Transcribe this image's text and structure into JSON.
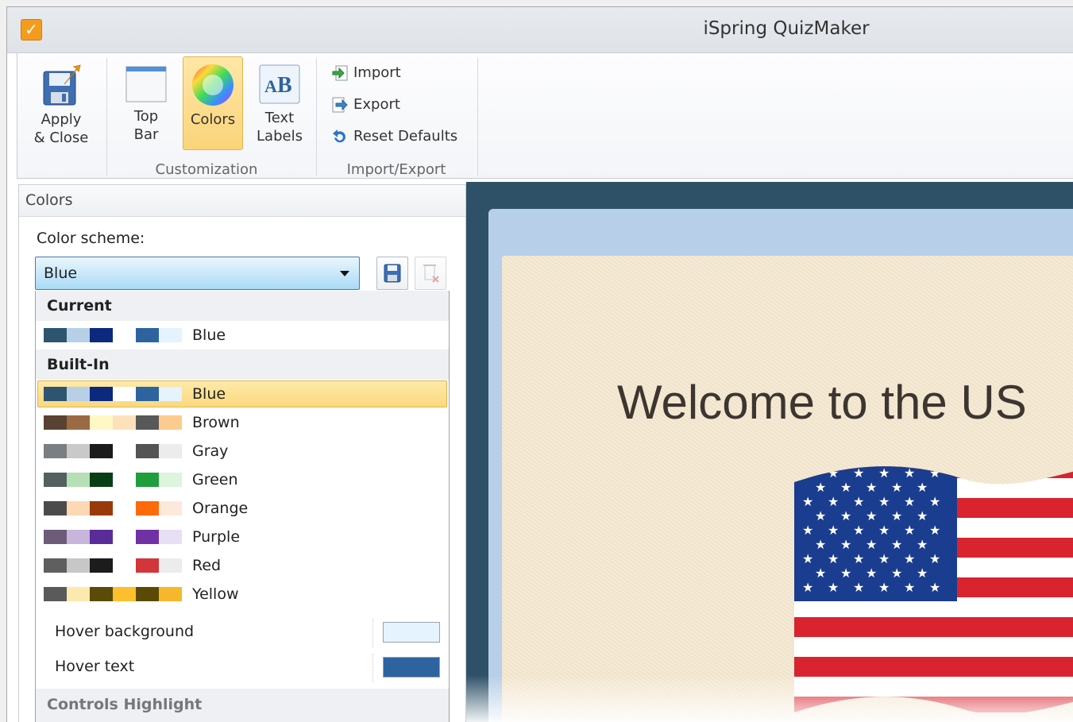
{
  "window": {
    "title": "iSpring QuizMaker",
    "app_icon": "checkbox-icon"
  },
  "ribbon": {
    "apply_close": {
      "line1": "Apply",
      "line2": "& Close",
      "icon": "save-apply-icon"
    },
    "top_bar": {
      "line1": "Top",
      "line2": "Bar",
      "icon": "window-icon"
    },
    "colors": {
      "label": "Colors",
      "icon": "color-wheel-icon",
      "active": true
    },
    "text_labels": {
      "line1": "Text",
      "line2": "Labels",
      "icon": "text-ab-icon"
    },
    "import": {
      "label": "Import",
      "icon": "import-icon"
    },
    "export": {
      "label": "Export",
      "icon": "export-icon"
    },
    "reset_defaults": {
      "label": "Reset Defaults",
      "icon": "undo-icon"
    },
    "groups": {
      "customization": "Customization",
      "import_export": "Import/Export"
    }
  },
  "panel": {
    "header": "Colors",
    "scheme_label": "Color scheme:",
    "scheme_value": "Blue",
    "dropdown": {
      "current_heading": "Current",
      "current": {
        "name": "Blue",
        "colors": [
          "#2e556f",
          "#b8cfe8",
          "#0b2a7e",
          "#ffffff",
          "#2d64a0",
          "#e4f3fd"
        ]
      },
      "builtin_heading": "Built-In",
      "schemes": [
        {
          "name": "Blue",
          "selected": true,
          "colors": [
            "#2e556f",
            "#b8cfe8",
            "#0b2a7e",
            "#ffffff",
            "#2d64a0",
            "#e4f3fd"
          ]
        },
        {
          "name": "Brown",
          "colors": [
            "#5a4232",
            "#9a6a44",
            "#fff8c4",
            "#fde1bb",
            "#585858",
            "#fccc8e"
          ]
        },
        {
          "name": "Gray",
          "colors": [
            "#7a7f84",
            "#c9c9c9",
            "#1b1b1b",
            "#ffffff",
            "#545454",
            "#ececec"
          ]
        },
        {
          "name": "Green",
          "colors": [
            "#53605f",
            "#b6dfb5",
            "#073e16",
            "#ffffff",
            "#1e9f3c",
            "#dcf5dc"
          ]
        },
        {
          "name": "Orange",
          "colors": [
            "#4b4b4b",
            "#fcd8b4",
            "#993a0a",
            "#ffffff",
            "#ff6a08",
            "#fde9dc"
          ]
        },
        {
          "name": "Purple",
          "colors": [
            "#6c5c7a",
            "#c7b5dc",
            "#5a2c9a",
            "#ffffff",
            "#7031a4",
            "#e7e0f4"
          ]
        },
        {
          "name": "Red",
          "colors": [
            "#5f5f5f",
            "#c7c7c7",
            "#1c1c1c",
            "#ffffff",
            "#d2353a",
            "#ececec"
          ]
        },
        {
          "name": "Yellow",
          "colors": [
            "#5a5a5a",
            "#fde9ae",
            "#5a4c08",
            "#ffbe2c",
            "#5a4a05",
            "#f6b82a"
          ]
        }
      ]
    },
    "properties": [
      {
        "label": "Hover background",
        "color": "#e4f3fd"
      },
      {
        "label": "Hover text",
        "color": "#2d64a0"
      }
    ],
    "controls_highlight": "Controls Highlight"
  },
  "preview": {
    "slide_title": "Welcome to the US",
    "image": "us-flag-image"
  }
}
